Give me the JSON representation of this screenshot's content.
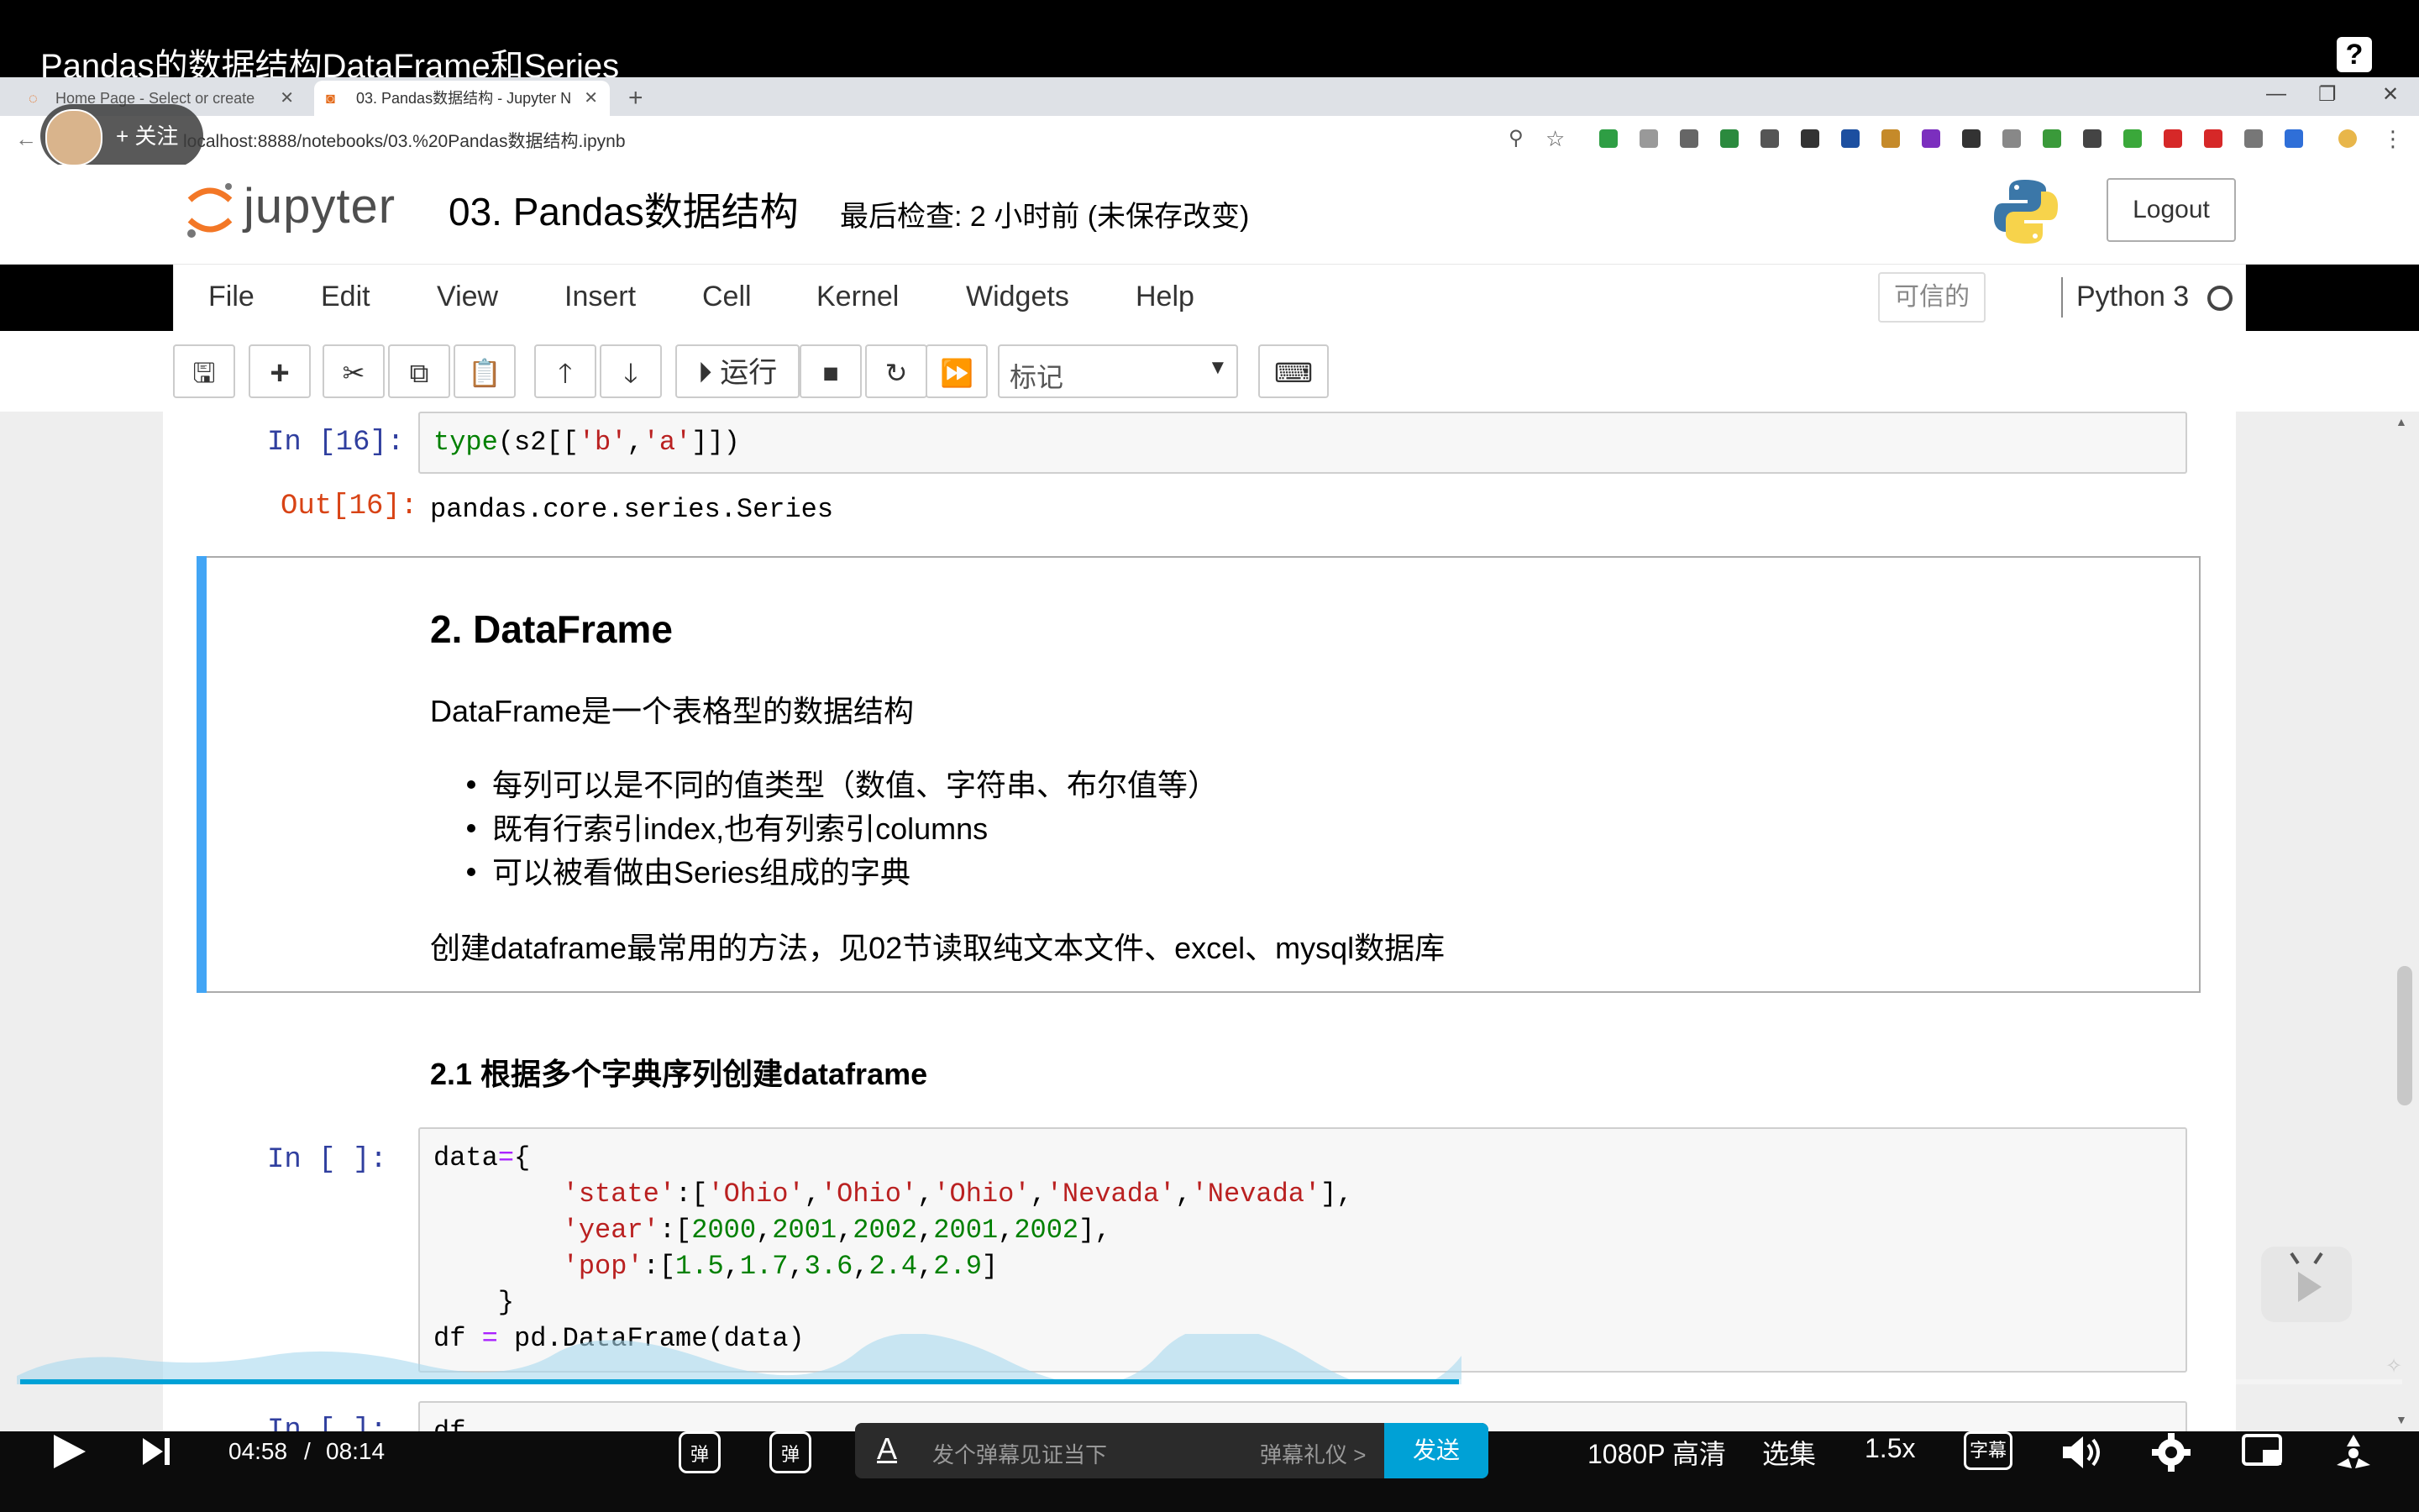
{
  "video": {
    "title": "Pandas的数据结构DataFrame和Series",
    "help": "?"
  },
  "follow": {
    "label": "+ 关注"
  },
  "browser": {
    "tabs": [
      {
        "label": "Home Page - Select or create"
      },
      {
        "label": "03. Pandas数据结构 - Jupyter N"
      }
    ],
    "url": "localhost:8888/notebooks/03.%20Pandas数据结构.ipynb"
  },
  "jupyter": {
    "logo_text": "jupyter",
    "notebook_title": "03. Pandas数据结构",
    "checkpoint": "最后检查: 2 小时前   (未保存改变)",
    "logout": "Logout",
    "menu": [
      "File",
      "Edit",
      "View",
      "Insert",
      "Cell",
      "Kernel",
      "Widgets",
      "Help"
    ],
    "trusted": "可信的",
    "kernel": "Python 3",
    "run_label": "运行",
    "cell_type": "标记"
  },
  "cells": {
    "c16": {
      "in_prompt": "In  [16]:",
      "out_prompt": "Out[16]:",
      "output": "pandas.core.series.Series"
    },
    "markdown": {
      "heading": "2. DataFrame",
      "para": "DataFrame是一个表格型的数据结构",
      "bullets": [
        "每列可以是不同的值类型（数值、字符串、布尔值等）",
        "既有行索引index,也有列索引columns",
        "可以被看做由Series组成的字典"
      ],
      "para2": "创建dataframe最常用的方法，见02节读取纯文本文件、excel、mysql数据库"
    },
    "subheading": "2.1 根据多个字典序列创建dataframe",
    "c_data": {
      "in_prompt": "In  [  ]:"
    },
    "c_next": {
      "in_prompt": "In  [  ]:",
      "code": "df"
    }
  },
  "player": {
    "time_current": "04:58",
    "time_sep": "/",
    "time_total": "08:14",
    "progress": 0.604,
    "danmaku_placeholder": "发个弹幕见证当下",
    "danmaku_gift": "弹幕礼仪 >",
    "send": "发送",
    "quality": "1080P 高清",
    "episodes": "选集",
    "speed": "1.5x",
    "subtitle": "字幕",
    "danmaku_on_icon": "弹",
    "accent": "#00a1d6"
  },
  "colors": {
    "jupyter_orange": "#f37726",
    "md_selected_bar": "#42a5f5",
    "prompt_in": "#303f9f",
    "prompt_out": "#d84315"
  }
}
